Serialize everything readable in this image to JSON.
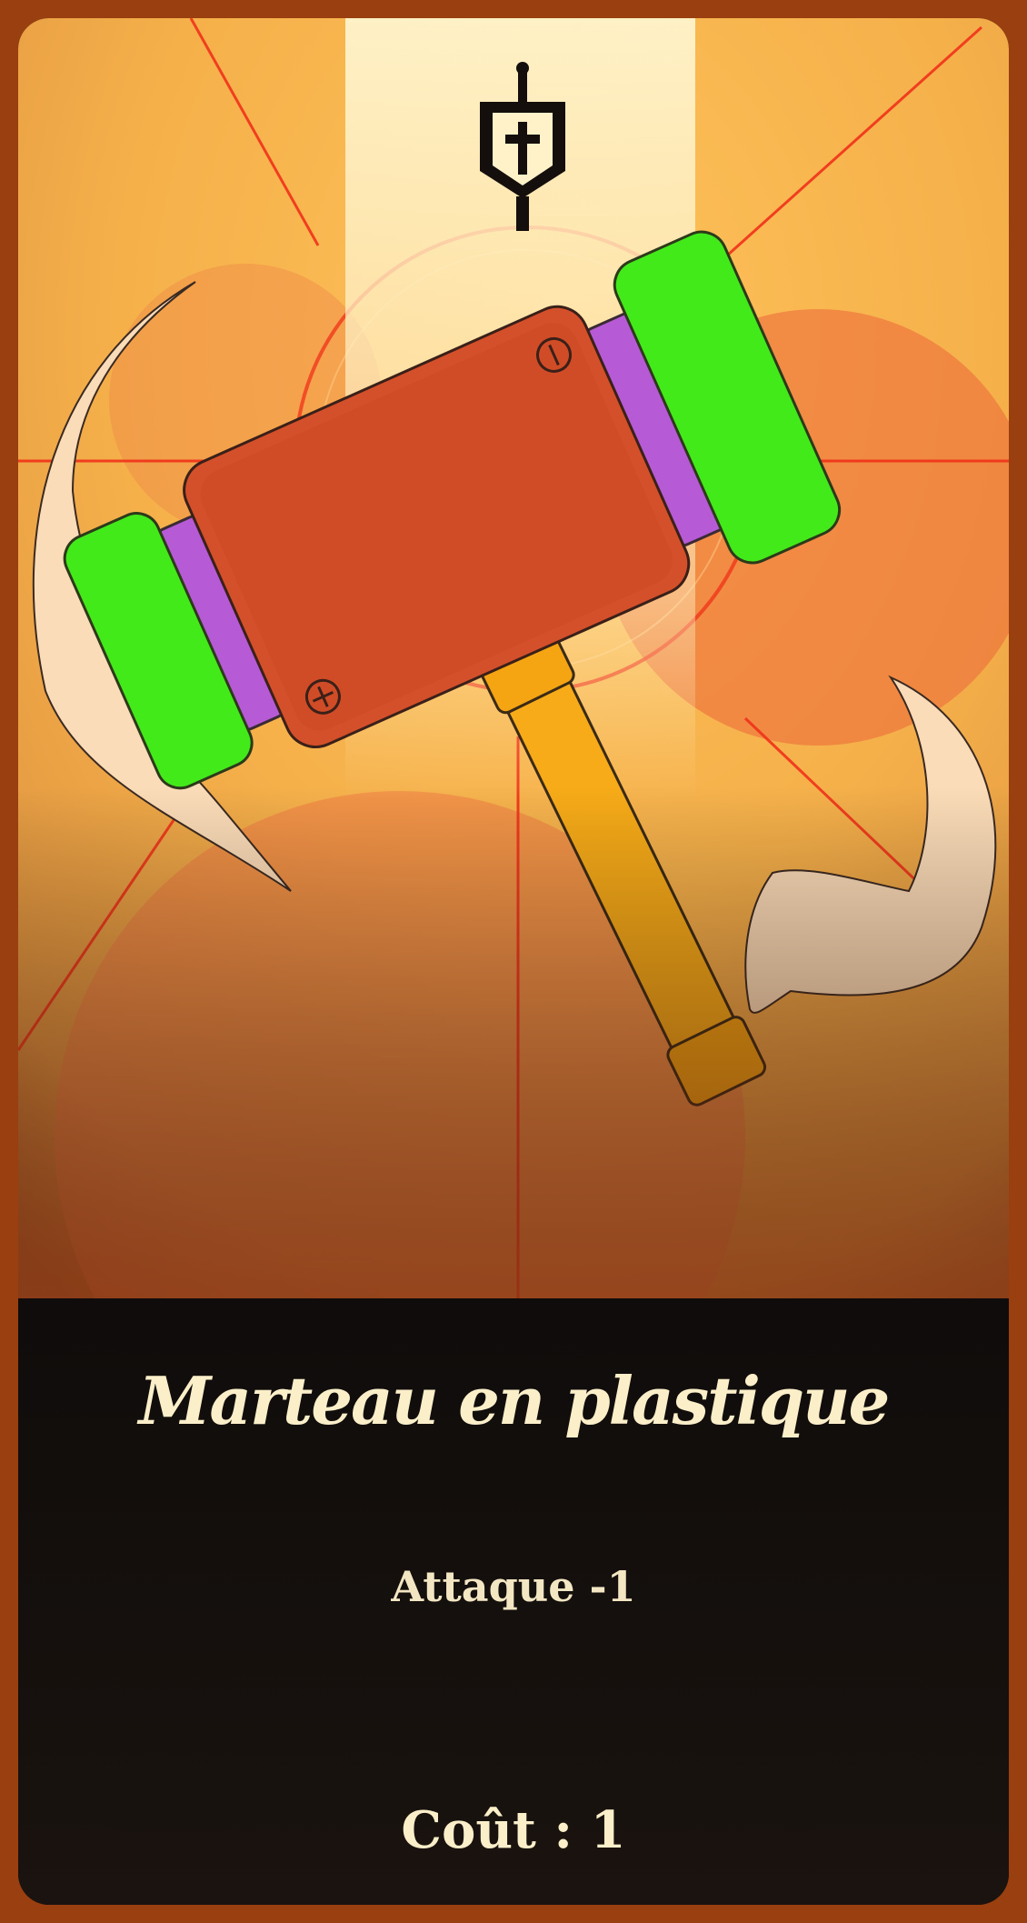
{
  "card": {
    "title": "Marteau en plastique",
    "effect": "Attaque -1",
    "cost_label": "Coût : 1",
    "class_icon": "shield-cross-icon",
    "illustration": "plastic-toy-hammer"
  },
  "colors": {
    "border": "#9a3f10",
    "panel": "#140f0c",
    "title_text": "#fbefc9",
    "art_background": "#f3b14a",
    "hammer_head": "#d4502a",
    "hammer_caps": "#43ea1a",
    "hammer_bands": "#b65ad6",
    "hammer_handle": "#f7ab18",
    "accent_lines": "#f0321a"
  }
}
